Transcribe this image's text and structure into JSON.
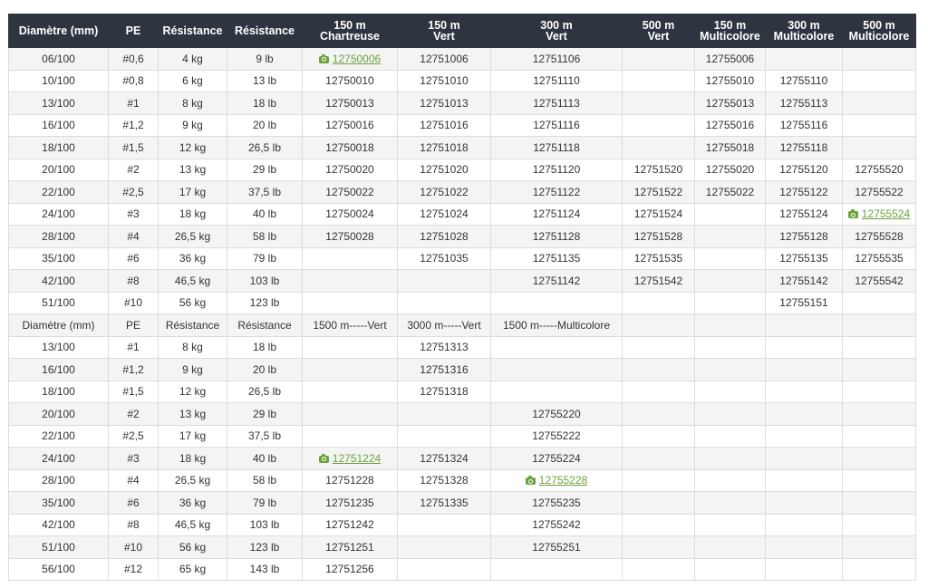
{
  "table": {
    "headers": [
      [
        "Diamètre (mm)"
      ],
      [
        "PE"
      ],
      [
        "Résistance"
      ],
      [
        "Résistance"
      ],
      [
        "150 m",
        "Chartreuse"
      ],
      [
        "150 m",
        "Vert"
      ],
      [
        "300 m",
        "Vert"
      ],
      [
        "500 m",
        "Vert"
      ],
      [
        "150 m",
        "Multicolore"
      ],
      [
        "300 m",
        "Multicolore"
      ],
      [
        "500 m",
        "Multicolore"
      ]
    ],
    "rows": [
      [
        "06/100",
        "#0,6",
        "4 kg",
        "9 lb",
        "12750006",
        "12751006",
        "12751106",
        "",
        "12755006",
        "",
        ""
      ],
      [
        "10/100",
        "#0,8",
        "6 kg",
        "13 lb",
        "12750010",
        "12751010",
        "12751110",
        "",
        "12755010",
        "12755110",
        ""
      ],
      [
        "13/100",
        "#1",
        "8 kg",
        "18 lb",
        "12750013",
        "12751013",
        "12751113",
        "",
        "12755013",
        "12755113",
        ""
      ],
      [
        "16/100",
        "#1,2",
        "9 kg",
        "20 lb",
        "12750016",
        "12751016",
        "12751116",
        "",
        "12755016",
        "12755116",
        ""
      ],
      [
        "18/100",
        "#1,5",
        "12 kg",
        "26,5 lb",
        "12750018",
        "12751018",
        "12751118",
        "",
        "12755018",
        "12755118",
        ""
      ],
      [
        "20/100",
        "#2",
        "13 kg",
        "29 lb",
        "12750020",
        "12751020",
        "12751120",
        "12751520",
        "12755020",
        "12755120",
        "12755520"
      ],
      [
        "22/100",
        "#2,5",
        "17 kg",
        "37,5 lb",
        "12750022",
        "12751022",
        "12751122",
        "12751522",
        "12755022",
        "12755122",
        "12755522"
      ],
      [
        "24/100",
        "#3",
        "18 kg",
        "40 lb",
        "12750024",
        "12751024",
        "12751124",
        "12751524",
        "",
        "12755124",
        "12755524"
      ],
      [
        "28/100",
        "#4",
        "26,5 kg",
        "58 lb",
        "12750028",
        "12751028",
        "12751128",
        "12751528",
        "",
        "12755128",
        "12755528"
      ],
      [
        "35/100",
        "#6",
        "36 kg",
        "79 lb",
        "",
        "12751035",
        "12751135",
        "12751535",
        "",
        "12755135",
        "12755535"
      ],
      [
        "42/100",
        "#8",
        "46,5 kg",
        "103 lb",
        "",
        "",
        "12751142",
        "12751542",
        "",
        "12755142",
        "12755542"
      ],
      [
        "51/100",
        "#10",
        "56 kg",
        "123 lb",
        "",
        "",
        "",
        "",
        "",
        "12755151",
        ""
      ],
      [
        "Diamètre (mm)",
        "PE",
        "Résistance",
        "Résistance",
        "1500 m-----Vert",
        "3000 m-----Vert",
        "1500 m-----Multicolore",
        "",
        "",
        "",
        ""
      ],
      [
        "13/100",
        "#1",
        "8 kg",
        "18 lb",
        "",
        "12751313",
        "",
        "",
        "",
        "",
        ""
      ],
      [
        "16/100",
        "#1,2",
        "9 kg",
        "20 lb",
        "",
        "12751316",
        "",
        "",
        "",
        "",
        ""
      ],
      [
        "18/100",
        "#1,5",
        "12 kg",
        "26,5 lb",
        "",
        "12751318",
        "",
        "",
        "",
        "",
        ""
      ],
      [
        "20/100",
        "#2",
        "13 kg",
        "29 lb",
        "",
        "",
        "12755220",
        "",
        "",
        "",
        ""
      ],
      [
        "22/100",
        "#2,5",
        "17 kg",
        "37,5 lb",
        "",
        "",
        "12755222",
        "",
        "",
        "",
        ""
      ],
      [
        "24/100",
        "#3",
        "18 kg",
        "40 lb",
        "12751224",
        "12751324",
        "12755224",
        "",
        "",
        "",
        ""
      ],
      [
        "28/100",
        "#4",
        "26,5 kg",
        "58 lb",
        "12751228",
        "12751328",
        "12755228",
        "",
        "",
        "",
        ""
      ],
      [
        "35/100",
        "#6",
        "36 kg",
        "79 lb",
        "12751235",
        "12751335",
        "12755235",
        "",
        "",
        "",
        ""
      ],
      [
        "42/100",
        "#8",
        "46,5 kg",
        "103 lb",
        "12751242",
        "",
        "12755242",
        "",
        "",
        "",
        ""
      ],
      [
        "51/100",
        "#10",
        "56 kg",
        "123 lb",
        "12751251",
        "",
        "12755251",
        "",
        "",
        "",
        ""
      ],
      [
        "56/100",
        "#12",
        "65 kg",
        "143 lb",
        "12751256",
        "",
        "",
        "",
        "",
        "",
        ""
      ]
    ],
    "links": [
      {
        "row": 0,
        "col": 4,
        "icon": "camera-icon"
      },
      {
        "row": 7,
        "col": 10,
        "icon": "camera-icon"
      },
      {
        "row": 18,
        "col": 4,
        "icon": "camera-icon"
      },
      {
        "row": 19,
        "col": 6,
        "icon": "camera-icon"
      }
    ],
    "subheader_row": 12,
    "colors": {
      "header_bg": "#2e3440",
      "header_text": "#ffffff",
      "row_odd": "#f4f4f4",
      "row_even": "#ffffff",
      "border": "#dcdcdc",
      "link": "#6aa23c"
    }
  }
}
